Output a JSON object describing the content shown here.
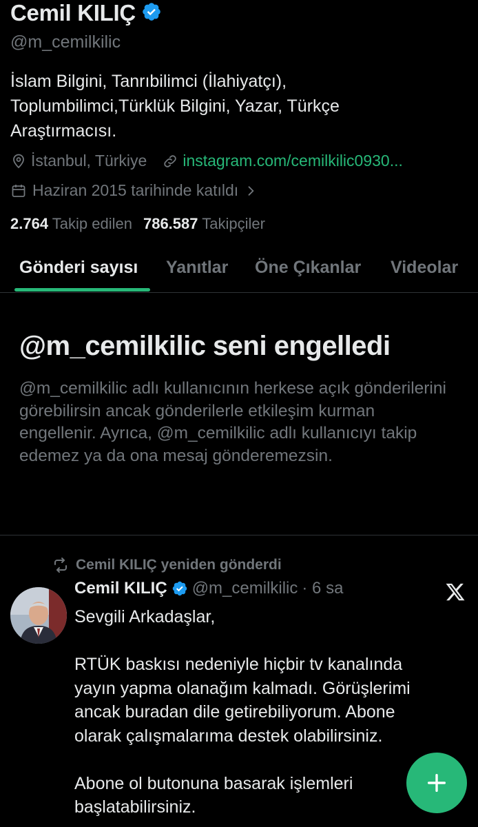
{
  "profile": {
    "name": "Cemil KILIÇ",
    "handle": "@m_cemilkilic",
    "bio": "İslam Bilgini, Tanrıbilimci (İlahiyatçı), Toplumbilimci,Türklük Bilgini, Yazar, Türkçe Araştırmacısı.",
    "location": "İstanbul, Türkiye",
    "website": "instagram.com/cemilkilic0930...",
    "joined": "Haziran 2015 tarihinde katıldı",
    "following_count": "2.764",
    "following_label": "Takip edilen",
    "followers_count": "786.587",
    "followers_label": "Takipçiler"
  },
  "tabs": [
    "Gönderi sayısı",
    "Yanıtlar",
    "Öne Çıkanlar",
    "Videolar"
  ],
  "blocked": {
    "title": "@m_cemilkilic seni engelledi",
    "description": "@m_cemilkilic adlı kullanıcının herkese açık gönderilerini görebilirsin ancak gönderilerle etkileşim kurman engellenir. Ayrıca, @m_cemilkilic adlı kullanıcıyı takip edemez ya da ona mesaj gönderemezsin."
  },
  "post": {
    "repost_label": "Cemil KILIÇ yeniden gönderdi",
    "author": "Cemil KILIÇ",
    "handle": "@m_cemilkilic",
    "time": "· 6 sa",
    "text": "Sevgili Arkadaşlar,\n\nRTÜK baskısı nedeniyle hiçbir tv kanalında yayın yapma olanağım kalmadı. Görüşlerimi ancak buradan dile getirebiliyorum. Abone olarak çalışmalarıma destek olabilirsiniz.\n\nAbone ol butonuna basarak işlemleri başlatabilirsiniz."
  },
  "colors": {
    "accent": "#27b878",
    "verified": "#1d9bf0",
    "muted": "#71767b"
  },
  "icons": [
    "verified-badge-icon",
    "location-icon",
    "link-icon",
    "calendar-icon",
    "chevron-right-icon",
    "repost-icon",
    "x-logo-icon",
    "plus-icon"
  ]
}
